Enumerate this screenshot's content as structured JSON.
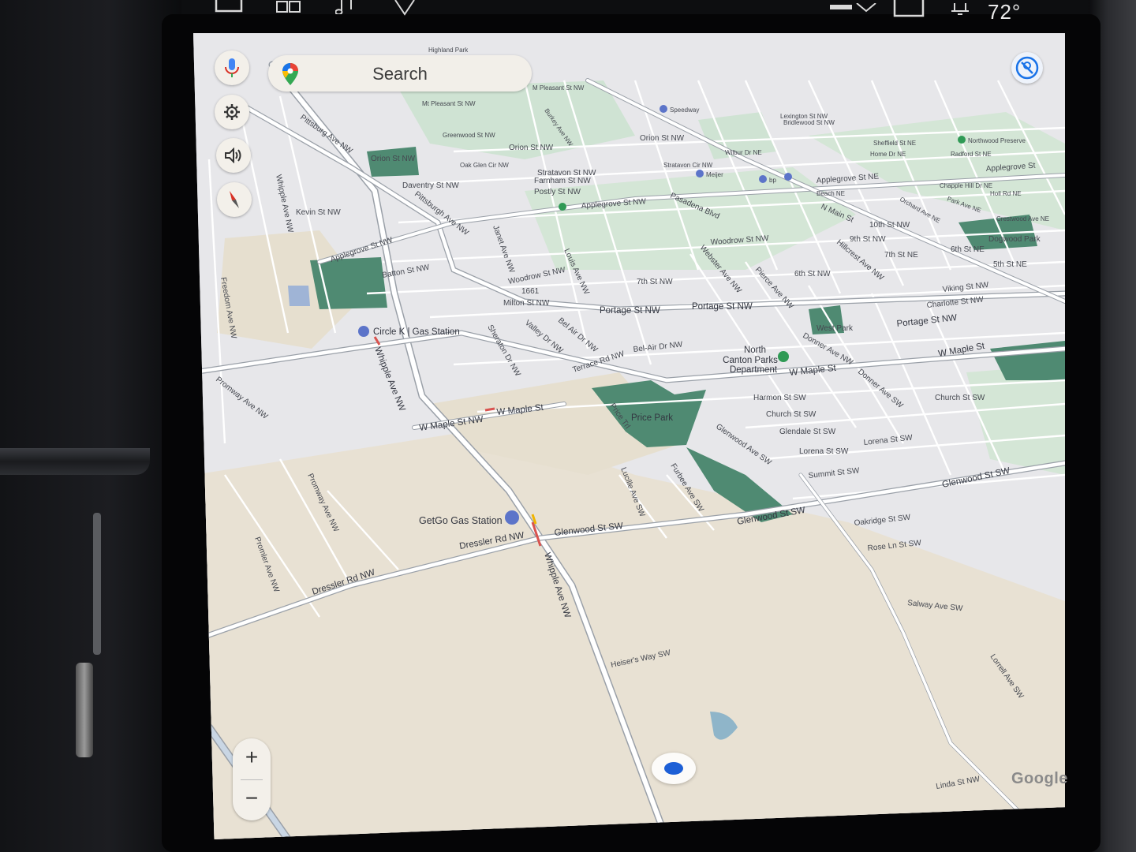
{
  "system_bar": {
    "temperature": "72°",
    "icons": [
      "window-icon",
      "grid-icon",
      "music-note-icon",
      "navigation-icon",
      "signal-icon",
      "phone-icon",
      "bell-icon"
    ]
  },
  "search": {
    "label": "Search",
    "icon": "google-maps-pin-icon"
  },
  "left_controls": [
    {
      "name": "microphone-button",
      "icon": "microphone-icon"
    },
    {
      "name": "settings-button",
      "icon": "gear-icon"
    },
    {
      "name": "volume-button",
      "icon": "speaker-icon"
    },
    {
      "name": "compass-button",
      "icon": "compass-icon"
    }
  ],
  "right_controls": [
    {
      "name": "voice-guidance-off-button",
      "icon": "muted-voice-icon"
    }
  ],
  "zoom": {
    "in_label": "+",
    "out_label": "−"
  },
  "attribution": "Google",
  "colors": {
    "map_background": "#e7e7ea",
    "park": "#b9d9c8",
    "dark_park": "#4f8a72",
    "sand": "#e8e1d3",
    "road": "#ffffff",
    "road_outline": "#9aa0a8",
    "location_dot": "#1d5fd6",
    "poi_blue": "#5c74c9",
    "poi_green": "#2f9a55"
  },
  "poi": {
    "circle_k": "Circle K | Gas Station",
    "getgo": "GetGo Gas Station",
    "north_canton_1": "North",
    "north_canton_2": "Canton Parks",
    "north_canton_3": "Department",
    "price_park": "Price Park",
    "west_park": "West Park",
    "dogwood_park": "Dogwood Park",
    "northwood_preserve": "Northwood Preserve",
    "speedway": "Speedway",
    "meijer": "Meijer",
    "bp": "bp"
  },
  "streets": {
    "whipple_1": "Whipple Ave NW",
    "whipple_2": "Whipple Ave NW",
    "w_maple_1": "W Maple St NW",
    "w_maple_2": "W Maple St",
    "w_maple_3": "W Maple St",
    "w_maple_4": "W Maple St",
    "dressler_1": "Dressler Rd NW",
    "dressler_2": "Dressler Rd NW",
    "glenwood_1": "Glenwood St SW",
    "glenwood_2": "Glenwood St SW",
    "glenwood_3": "Glenwood St SW",
    "portage_1": "Portage St NW",
    "portage_2": "Portage St NW",
    "portage_3": "Portage St NW",
    "applegrove_1": "Applegrove St NW",
    "applegrove_2": "Applegrove St NW",
    "applegrove_3": "Applegrove St NE",
    "applegrove_4": "Applegrove St",
    "pittsburg": "Pittsburg Ave NW",
    "pittsburgh_2": "Pittsburgh Ave NW",
    "orion_1": "Orion St NW",
    "orion_2": "Orion St NW",
    "orion_3": "Orion St NW",
    "kevin": "Kevin St NW",
    "daventry": "Daventry St NW",
    "batton": "Batton St NW",
    "milton": "Milton St NW",
    "woodrow_1": "Woodrow St NW",
    "woodrow_2": "Woodrow St NW",
    "7th": "7th St NW",
    "6th": "6th St NW",
    "9th": "9th St NW",
    "10th": "10th St NW",
    "7th_ne": "7th St NE",
    "6th_ne": "6th St NE",
    "5th_ne": "5th St NE",
    "bel_air_1": "Bel Air Dr NW",
    "bel_air_2": "Bel-Air Dr NW",
    "valley": "Valley Dr NW",
    "sheraton": "Sheraton Dr NW",
    "terrace": "Terrace Rd NW",
    "janet": "Janet Ave NW",
    "louis": "Louis Ave NW",
    "webster": "Webster Ave NW",
    "pierce": "Pierce Ave NW",
    "donner_1": "Donner Ave NW",
    "donner_2": "Donner Ave SW",
    "harmon": "Harmon St SW",
    "church_1": "Church St SW",
    "church_2": "Church St SW",
    "glendale": "Glendale St SW",
    "lorena_1": "Lorena St SW",
    "lorena_2": "Lorena St SW",
    "summit": "Summit St SW",
    "oakridge": "Oakridge St SW",
    "rose_ln": "Rose Ln St SW",
    "salway": "Salway Ave SW",
    "lorrell": "Lorrell Ave SW",
    "linda": "Linda St NW",
    "heisers": "Heiser's Way SW",
    "lucille": "Lucille Ave SW",
    "furbee": "Furbee Ave SW",
    "glenwood_ave": "Glenwood Ave SW",
    "price_trl": "Price Trl",
    "promway_1": "Promway Ave NW",
    "promway_2": "Promway Ave NW",
    "promler": "Promler Ave NW",
    "freedom": "Freedom Ave NW",
    "whipple_top": "Whipple Ave NW",
    "viking": "Viking St NW",
    "charlotte": "Charlotte St NW",
    "portage_ne": "Portage St NW",
    "maple_ne": "W Maple St",
    "church_ne": "Church St SW",
    "stratavon": "Stratavon St NW",
    "farnham": "Farnham St NW",
    "postly": "Postly St NW",
    "n_main": "N Main St",
    "pasadena": "Pasadena Blvd",
    "hillcrest": "Hillcrest Ave NW",
    "route": "1661",
    "oak_glen": "Oak Glen Cir NW",
    "orchard": "Orchard Ave NE",
    "highland": "Highland Park",
    "stratavon_ne": "Stratavon Cir NW",
    "wilbur": "Wilbur Dr NE",
    "chapple": "Chapple Hill Dr NE",
    "holl": "Holl Rd NE",
    "radford": "Radford St NE",
    "sheffield": "Sheffield St NE",
    "home": "Home Dr NE",
    "beach": "Beach NE",
    "crestwood": "Crestwood Ave NE",
    "lexington": "Lexington St NW",
    "bridlewood": "Bridlewood St NW",
    "m_pleasant_1": "M Pleasant St NW",
    "m_pleasant_2": "Mt Pleasant St NW",
    "greenwood": "Greenwood St NW",
    "burkey": "Burkey Ave NW",
    "park_ave": "Park Ave NE"
  }
}
